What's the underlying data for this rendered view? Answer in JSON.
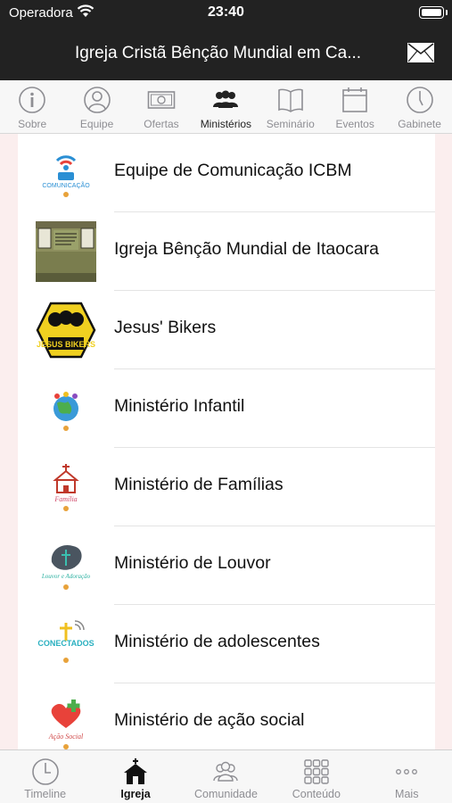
{
  "status_bar": {
    "carrier": "Operadora",
    "time": "23:40"
  },
  "nav": {
    "title": "Igreja Cristã Bênção Mundial em Ca..."
  },
  "top_tabs": [
    {
      "label": "Sobre"
    },
    {
      "label": "Equipe"
    },
    {
      "label": "Ofertas"
    },
    {
      "label": "Ministérios"
    },
    {
      "label": "Seminário"
    },
    {
      "label": "Eventos"
    },
    {
      "label": "Gabinete"
    }
  ],
  "ministries": [
    {
      "title": "Equipe de Comunicação ICBM",
      "thumb_text": "COMUNICAÇÃO"
    },
    {
      "title": "Igreja Bênção Mundial de Itaocara",
      "thumb_text": ""
    },
    {
      "title": "Jesus' Bikers",
      "thumb_text": "JESUS BIKERS"
    },
    {
      "title": "Ministério Infantil",
      "thumb_text": ""
    },
    {
      "title": "Ministério de Famílias",
      "thumb_text": "Família"
    },
    {
      "title": "Ministério de Louvor",
      "thumb_text": "Louvor e Adoração"
    },
    {
      "title": "Ministério de adolescentes",
      "thumb_text": "CONECTADOS"
    },
    {
      "title": "Ministério de ação social",
      "thumb_text": "Ação Social"
    }
  ],
  "bottom_tabs": [
    {
      "label": "Timeline"
    },
    {
      "label": "Igreja"
    },
    {
      "label": "Comunidade"
    },
    {
      "label": "Conteúdo"
    },
    {
      "label": "Mais"
    }
  ],
  "colors": {
    "bar_bg": "#222222",
    "content_bg": "#fbeeee",
    "inactive": "#8e8e93",
    "active": "#111111"
  },
  "icons": {
    "top_tabs": [
      "info-icon",
      "person-icon",
      "banknote-icon",
      "group-icon",
      "book-icon",
      "calendar-icon",
      "clock-icon"
    ],
    "bottom_tabs": [
      "clock-icon",
      "church-icon",
      "people-icon",
      "grid-icon",
      "more-icon"
    ]
  }
}
